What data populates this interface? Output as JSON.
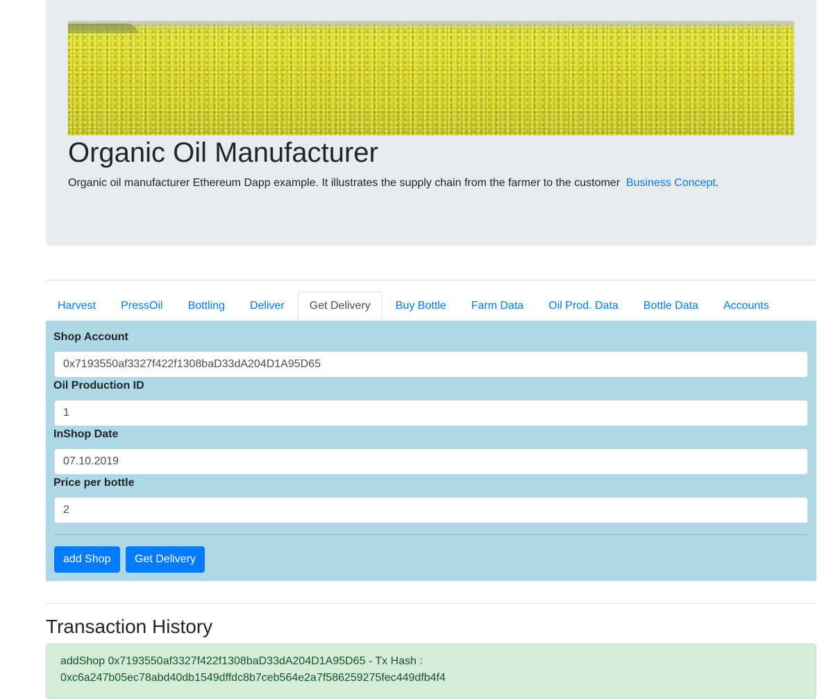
{
  "header": {
    "title": "Organic Oil Manufacturer",
    "description": "Organic oil manufacturer Ethereum Dapp example. It illustrates the supply chain from the farmer to the customer",
    "link_text": "Business Concept",
    "link_suffix": "."
  },
  "tabs": [
    {
      "label": "Harvest",
      "active": false
    },
    {
      "label": "PressOil",
      "active": false
    },
    {
      "label": "Bottling",
      "active": false
    },
    {
      "label": "Deliver",
      "active": false
    },
    {
      "label": "Get Delivery",
      "active": true
    },
    {
      "label": "Buy Bottle",
      "active": false
    },
    {
      "label": "Farm Data",
      "active": false
    },
    {
      "label": "Oil Prod. Data",
      "active": false
    },
    {
      "label": "Bottle Data",
      "active": false
    },
    {
      "label": "Accounts",
      "active": false
    }
  ],
  "form": {
    "shop_account": {
      "label": "Shop Account",
      "value": "0x7193550af3327f422f1308baD33dA204D1A95D65"
    },
    "oil_production_id": {
      "label": "Oil Production ID",
      "value": "1"
    },
    "inshop_date": {
      "label": "InShop Date",
      "value": "07.10.2019"
    },
    "price_per_bottle": {
      "label": "Price per bottle",
      "value": "2"
    }
  },
  "buttons": {
    "add_shop": "add Shop",
    "get_delivery": "Get Delivery"
  },
  "history": {
    "title": "Transaction History",
    "entries": [
      {
        "line1": "addShop 0x7193550af3327f422f1308baD33dA204D1A95D65 - Tx Hash :",
        "line2": "0xc6a247b05ec78abd40db1549dffdc8b7ceb564e2a7f586259275fec449dfb4f4"
      }
    ]
  },
  "colors": {
    "accent": "#007bff",
    "panel": "#add8e6",
    "jumbotron": "#e9ecef",
    "success_bg": "#d4edda",
    "success_text": "#155724"
  },
  "images": {
    "banner": "rapeseed-field-banner"
  }
}
